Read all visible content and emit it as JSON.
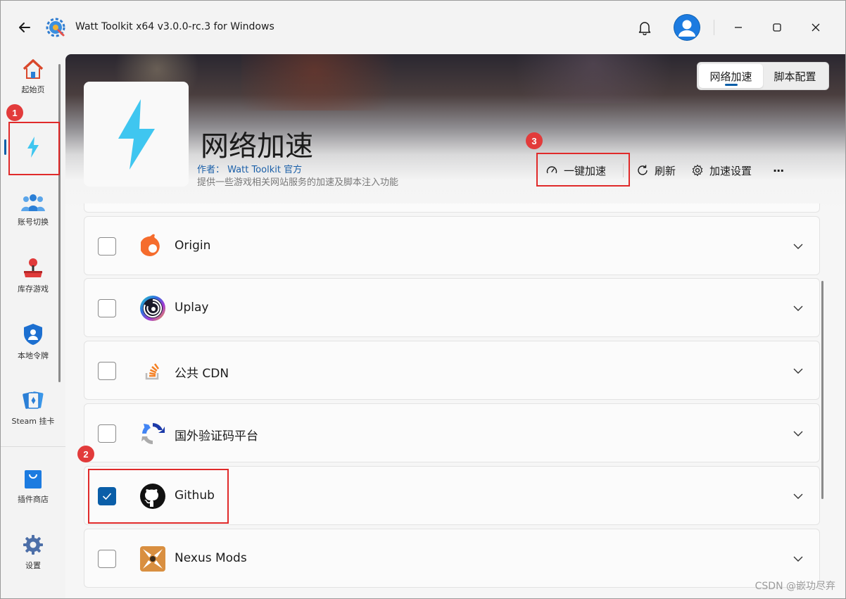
{
  "window": {
    "title": "Watt Toolkit x64 v3.0.0-rc.3 for Windows"
  },
  "sidebar": {
    "items": [
      {
        "label": "起始页",
        "icon": "home-icon"
      },
      {
        "label": "",
        "icon": "lightning-icon",
        "active": true
      },
      {
        "label": "账号切换",
        "icon": "users-icon"
      },
      {
        "label": "库存游戏",
        "icon": "joystick-icon"
      },
      {
        "label": "本地令牌",
        "icon": "shield-user-icon"
      },
      {
        "label": "Steam 挂卡",
        "icon": "cards-icon"
      },
      {
        "label": "插件商店",
        "icon": "shopping-bag-icon"
      },
      {
        "label": "设置",
        "icon": "gear-icon"
      }
    ]
  },
  "header": {
    "tabs": [
      {
        "label": "网络加速",
        "active": true
      },
      {
        "label": "脚本配置",
        "active": false
      }
    ],
    "plugin_title": "网络加速",
    "plugin_author": "作者：  Watt Toolkit  官方",
    "plugin_description": "提供一些游戏相关网站服务的加速及脚本注入功能",
    "toolbar": {
      "accelerate_label": "一键加速",
      "refresh_label": "刷新",
      "settings_label": "加速设置",
      "more_label": "···"
    }
  },
  "list": {
    "items": [
      {
        "label": "Origin",
        "checked": false,
        "icon": "origin-icon"
      },
      {
        "label": "Uplay",
        "checked": false,
        "icon": "uplay-icon"
      },
      {
        "label": "公共 CDN",
        "checked": false,
        "icon": "stackoverflow-icon"
      },
      {
        "label": "国外验证码平台",
        "checked": false,
        "icon": "recaptcha-icon"
      },
      {
        "label": "Github",
        "checked": true,
        "icon": "github-icon"
      },
      {
        "label": "Nexus Mods",
        "checked": false,
        "icon": "nexusmods-icon"
      }
    ]
  },
  "annotations": {
    "badge1": "1",
    "badge2": "2",
    "badge3": "3"
  },
  "colors": {
    "accent": "#0a5ea8",
    "annotation_red": "#e02a2a",
    "lightning": "#3fc6f0"
  },
  "watermark": "CSDN @嵌功尽弃"
}
